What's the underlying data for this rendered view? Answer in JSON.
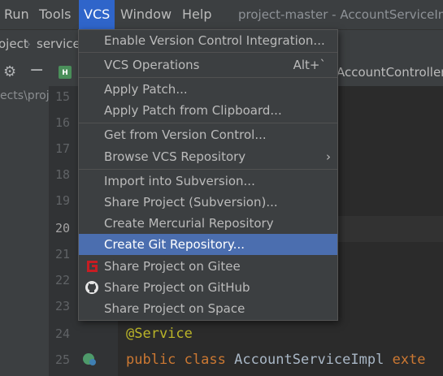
{
  "menubar": {
    "items": [
      "Run",
      "Tools",
      "VCS",
      "Window",
      "Help"
    ],
    "active": "VCS",
    "window_title": "project-master - AccountServiceIm"
  },
  "navbar": {
    "crumbs": [
      "oject",
      "service"
    ]
  },
  "project_panel": {
    "path_fragment": "ects\\proj"
  },
  "editor_tab": {
    "icon_letter": "H",
    "label": "AccountController"
  },
  "gutter": {
    "line_numbers": [
      "15",
      "16",
      "17",
      "18",
      "19",
      "20",
      "21",
      "22",
      "23",
      "24",
      "25"
    ],
    "current_line": "20"
  },
  "code": {
    "line24": "@Service",
    "line25_kw1": "public",
    "line25_kw2": "class",
    "line25_name": "AccountServiceImpl",
    "line25_tail": "exte"
  },
  "vcs_menu": {
    "items": [
      {
        "label": "Enable Version Control Integration...",
        "shortcut": "",
        "submenu": false
      },
      {
        "label": "VCS Operations",
        "shortcut": "Alt+`",
        "submenu": false
      },
      {
        "label": "Apply Patch...",
        "shortcut": "",
        "submenu": false
      },
      {
        "label": "Apply Patch from Clipboard...",
        "shortcut": "",
        "submenu": false
      },
      {
        "label": "Get from Version Control...",
        "shortcut": "",
        "submenu": false
      },
      {
        "label": "Browse VCS Repository",
        "shortcut": "",
        "submenu": true
      },
      {
        "label": "Import into Subversion...",
        "shortcut": "",
        "submenu": false
      },
      {
        "label": "Share Project (Subversion)...",
        "shortcut": "",
        "submenu": false
      },
      {
        "label": "Create Mercurial Repository",
        "shortcut": "",
        "submenu": false
      },
      {
        "label": "Create Git Repository...",
        "shortcut": "",
        "submenu": false,
        "selected": true
      },
      {
        "label": "Share Project on Gitee",
        "shortcut": "",
        "submenu": false,
        "icon": "gitee-icon"
      },
      {
        "label": "Share Project on GitHub",
        "shortcut": "",
        "submenu": false,
        "icon": "github-icon"
      },
      {
        "label": "Share Project on Space",
        "shortcut": "",
        "submenu": false
      }
    ],
    "submenu_arrow": "›"
  },
  "colors": {
    "menubar_bg": "#3c3f41",
    "editor_bg": "#2b2b2b",
    "selection": "#4b6eaf",
    "active_menu": "#2f65ca",
    "gitee": "#c71d23"
  }
}
